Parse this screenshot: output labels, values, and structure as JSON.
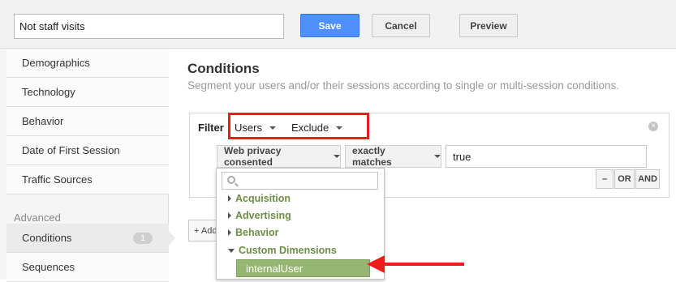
{
  "segment": {
    "name_value": "Not staff visits"
  },
  "toolbar": {
    "save_label": "Save",
    "cancel_label": "Cancel",
    "preview_label": "Preview"
  },
  "sidebar": {
    "items": [
      {
        "label": "Demographics"
      },
      {
        "label": "Technology"
      },
      {
        "label": "Behavior"
      },
      {
        "label": "Date of First Session"
      },
      {
        "label": "Traffic Sources"
      }
    ],
    "advanced_heading": "Advanced",
    "advanced_items": [
      {
        "label": "Conditions",
        "badge": "1"
      },
      {
        "label": "Sequences"
      }
    ]
  },
  "main": {
    "title": "Conditions",
    "subtitle": "Segment your users and/or their sessions according to single or multi-session conditions."
  },
  "filter": {
    "label": "Filter",
    "scope": "Users",
    "mode": "Exclude",
    "dimension": "Web privacy consented",
    "operator": "exactly matches",
    "value": "true",
    "minus_label": "–",
    "or_label": "OR",
    "and_label": "AND",
    "add_label": "+ Add Filter"
  },
  "dropdown": {
    "search_placeholder": "",
    "categories": [
      "Acquisition",
      "Advertising",
      "Behavior",
      "Custom Dimensions"
    ],
    "selected_item": "internalUser"
  },
  "colors": {
    "save_button": "#4d90fe",
    "highlight": "#ee1c1c",
    "category_text": "#6b8f45",
    "selected_item": "#95b772"
  }
}
